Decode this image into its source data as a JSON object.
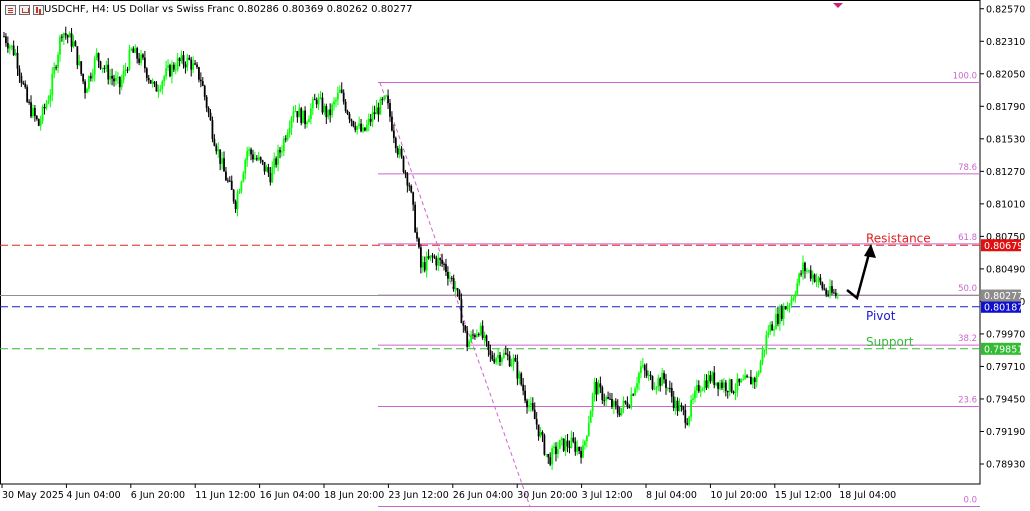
{
  "header": {
    "symbol": "USDCHF, H4:",
    "description": "US Dollar vs Swiss Franc",
    "ohlc": "0.80286 0.80369 0.80262 0.80277"
  },
  "colors": {
    "bull": "#00ff00",
    "bear": "#000000",
    "fib": "#cc66cc",
    "resistance": "#e02020",
    "pivot": "#1a1acc",
    "support": "#33bb33",
    "current": "#909090",
    "axis": "#000000"
  },
  "icons": [
    "candles-icon",
    "bars-icon",
    "linechart-icon",
    "one-click-marker-icon"
  ],
  "chart_data": {
    "type": "candlestick",
    "symbol": "USDCHF",
    "timeframe": "H4",
    "ylim": [
      0.7877,
      0.8264
    ],
    "y_ticks": [
      "0.82570",
      "0.82310",
      "0.82050",
      "0.81790",
      "0.81530",
      "0.81270",
      "0.81010",
      "0.80750",
      "0.80490",
      "0.80230",
      "0.79970",
      "0.79710",
      "0.79450",
      "0.79190",
      "0.78930"
    ],
    "x_ticks": [
      "30 May 2025",
      "4 Jun 04:00",
      "6 Jun 20:00",
      "11 Jun 12:00",
      "16 Jun 04:00",
      "18 Jun 20:00",
      "23 Jun 12:00",
      "26 Jun 04:00",
      "30 Jun 20:00",
      "3 Jul 12:00",
      "8 Jul 04:00",
      "10 Jul 20:00",
      "15 Jul 12:00",
      "18 Jul 04:00"
    ],
    "close_path": [
      [
        0,
        0.8235
      ],
      [
        6,
        0.8221
      ],
      [
        12,
        0.8182
      ],
      [
        18,
        0.8164
      ],
      [
        24,
        0.8191
      ],
      [
        30,
        0.824
      ],
      [
        36,
        0.8229
      ],
      [
        42,
        0.8193
      ],
      [
        48,
        0.8219
      ],
      [
        54,
        0.8205
      ],
      [
        60,
        0.8195
      ],
      [
        66,
        0.8223
      ],
      [
        72,
        0.8214
      ],
      [
        78,
        0.8192
      ],
      [
        84,
        0.8205
      ],
      [
        90,
        0.8214
      ],
      [
        96,
        0.8215
      ],
      [
        102,
        0.8201
      ],
      [
        108,
        0.8159
      ],
      [
        114,
        0.8126
      ],
      [
        120,
        0.8102
      ],
      [
        126,
        0.8144
      ],
      [
        132,
        0.8135
      ],
      [
        138,
        0.8124
      ],
      [
        144,
        0.8147
      ],
      [
        150,
        0.8178
      ],
      [
        156,
        0.8168
      ],
      [
        162,
        0.8185
      ],
      [
        168,
        0.8171
      ],
      [
        174,
        0.819
      ],
      [
        180,
        0.8169
      ],
      [
        186,
        0.8157
      ],
      [
        192,
        0.8174
      ],
      [
        198,
        0.8184
      ],
      [
        204,
        0.8145
      ],
      [
        210,
        0.8117
      ],
      [
        216,
        0.805
      ],
      [
        222,
        0.8058
      ],
      [
        228,
        0.8052
      ],
      [
        234,
        0.8034
      ],
      [
        240,
        0.7989
      ],
      [
        246,
        0.8002
      ],
      [
        252,
        0.7978
      ],
      [
        258,
        0.7981
      ],
      [
        264,
        0.7975
      ],
      [
        270,
        0.7948
      ],
      [
        276,
        0.7925
      ],
      [
        282,
        0.7896
      ],
      [
        288,
        0.7908
      ],
      [
        294,
        0.7909
      ],
      [
        300,
        0.7903
      ],
      [
        306,
        0.7955
      ],
      [
        312,
        0.7945
      ],
      [
        318,
        0.7935
      ],
      [
        324,
        0.7944
      ],
      [
        330,
        0.797
      ],
      [
        336,
        0.7958
      ],
      [
        342,
        0.7961
      ],
      [
        348,
        0.794
      ],
      [
        354,
        0.793
      ],
      [
        360,
        0.7955
      ],
      [
        366,
        0.7962
      ],
      [
        372,
        0.7957
      ],
      [
        378,
        0.7954
      ],
      [
        384,
        0.7958
      ],
      [
        390,
        0.7962
      ],
      [
        396,
        0.8
      ],
      [
        402,
        0.8013
      ],
      [
        408,
        0.8025
      ],
      [
        414,
        0.805
      ],
      [
        420,
        0.8043
      ],
      [
        426,
        0.803
      ],
      [
        432,
        0.8028
      ]
    ],
    "fibonacci": [
      {
        "label": "100.0",
        "price": 0.8198
      },
      {
        "label": "78.6",
        "price": 0.8125
      },
      {
        "label": "61.8",
        "price": 0.8069
      },
      {
        "label": "50.0",
        "price": 0.8028
      },
      {
        "label": "38.2",
        "price": 0.7988
      },
      {
        "label": "23.6",
        "price": 0.7939
      },
      {
        "label": "0.0",
        "price": 0.7859
      }
    ],
    "levels": [
      {
        "name": "Resistance",
        "price": 0.80679,
        "price_label": "0.80679"
      },
      {
        "name": "Pivot",
        "price": 0.80187,
        "price_label": "0.80187"
      },
      {
        "name": "Support",
        "price": 0.79851,
        "price_label": "0.79851"
      }
    ],
    "current_price": {
      "price": 0.80277,
      "label": "0.80277"
    }
  }
}
